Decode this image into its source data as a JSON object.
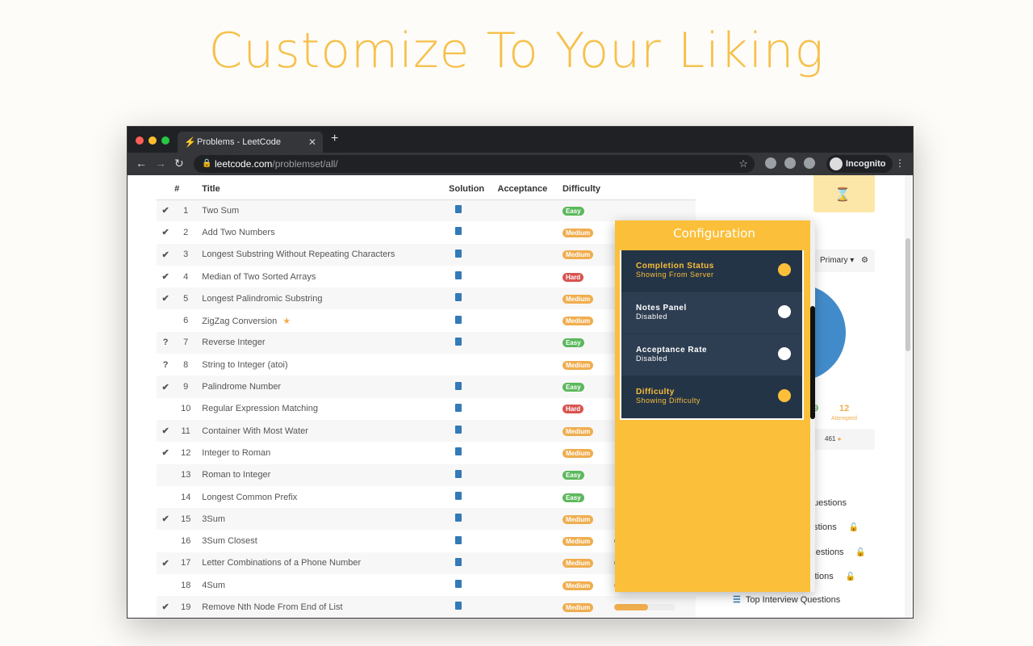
{
  "hero_title": "Customize To Your Liking",
  "browser": {
    "tab_title": "Problems - LeetCode",
    "url_host": "leetcode.com",
    "url_path": "/problemset/all/",
    "profile_label": "Incognito"
  },
  "table": {
    "headers": {
      "num": "#",
      "title": "Title",
      "solution": "Solution",
      "acceptance": "Acceptance",
      "difficulty": "Difficulty"
    },
    "rows": [
      {
        "status": "✔",
        "num": "1",
        "title": "Two Sum",
        "sol": true,
        "diff": "Easy"
      },
      {
        "status": "✔",
        "num": "2",
        "title": "Add Two Numbers",
        "sol": true,
        "diff": "Medium"
      },
      {
        "status": "✔",
        "num": "3",
        "title": "Longest Substring Without Repeating Characters",
        "sol": true,
        "diff": "Medium"
      },
      {
        "status": "✔",
        "num": "4",
        "title": "Median of Two Sorted Arrays",
        "sol": true,
        "diff": "Hard"
      },
      {
        "status": "✔",
        "num": "5",
        "title": "Longest Palindromic Substring",
        "sol": true,
        "diff": "Medium"
      },
      {
        "status": "",
        "num": "6",
        "title": "ZigZag Conversion",
        "star": true,
        "sol": true,
        "diff": "Medium"
      },
      {
        "status": "?",
        "num": "7",
        "title": "Reverse Integer",
        "sol": true,
        "diff": "Easy"
      },
      {
        "status": "?",
        "num": "8",
        "title": "String to Integer (atoi)",
        "sol": false,
        "diff": "Medium"
      },
      {
        "status": "✔",
        "num": "9",
        "title": "Palindrome Number",
        "sol": true,
        "diff": "Easy"
      },
      {
        "status": "",
        "num": "10",
        "title": "Regular Expression Matching",
        "sol": true,
        "diff": "Hard"
      },
      {
        "status": "✔",
        "num": "11",
        "title": "Container With Most Water",
        "sol": true,
        "diff": "Medium"
      },
      {
        "status": "✔",
        "num": "12",
        "title": "Integer to Roman",
        "sol": true,
        "diff": "Medium"
      },
      {
        "status": "",
        "num": "13",
        "title": "Roman to Integer",
        "sol": true,
        "diff": "Easy"
      },
      {
        "status": "",
        "num": "14",
        "title": "Longest Common Prefix",
        "sol": true,
        "diff": "Easy"
      },
      {
        "status": "✔",
        "num": "15",
        "title": "3Sum",
        "sol": true,
        "diff": "Medium"
      },
      {
        "status": "",
        "num": "16",
        "title": "3Sum Closest",
        "sol": true,
        "diff": "Medium",
        "freq": 0.65,
        "freq_color": "#5cb85c"
      },
      {
        "status": "✔",
        "num": "17",
        "title": "Letter Combinations of a Phone Number",
        "sol": true,
        "diff": "Medium",
        "freq": 0.78,
        "freq_color": "#5cb85c"
      },
      {
        "status": "",
        "num": "18",
        "title": "4Sum",
        "sol": true,
        "diff": "Medium",
        "freq": 0.57,
        "freq_color": "#f0ad4e"
      },
      {
        "status": "✔",
        "num": "19",
        "title": "Remove Nth Node From End of List",
        "sol": true,
        "diff": "Medium",
        "freq": 0.55,
        "freq_color": "#f0ad4e"
      }
    ]
  },
  "config": {
    "title": "Configuration",
    "options": [
      {
        "name": "Completion Status",
        "state": "Showing From Server",
        "on": true
      },
      {
        "name": "Notes Panel",
        "state": "Disabled",
        "on": false
      },
      {
        "name": "Acceptance Rate",
        "state": "Disabled",
        "on": false
      },
      {
        "name": "Difficulty",
        "state": "Showing Difficulty",
        "on": true
      }
    ]
  },
  "sidebar": {
    "session_select": "Primary",
    "attempted_count": "12",
    "attempted_label": "Attempted",
    "solved_partial": "9",
    "points": "461",
    "lists": [
      {
        "label": "uestions",
        "lock": false
      },
      {
        "label": "stions",
        "lock": true
      },
      {
        "label": "Top Facebook Questions",
        "lock": true
      },
      {
        "label": "Top Google Questions",
        "lock": true
      },
      {
        "label": "Top Interview Questions",
        "lock": false
      }
    ]
  },
  "colors": {
    "accent": "#fbbf39",
    "link": "#337ab7",
    "easy": "#5cb85c",
    "medium": "#f0ad4e",
    "hard": "#d9534f"
  }
}
